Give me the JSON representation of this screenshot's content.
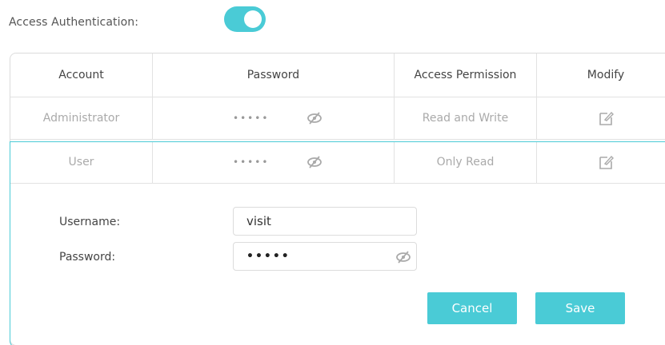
{
  "auth": {
    "label": "Access Authentication:",
    "enabled": true
  },
  "table": {
    "headers": [
      "Account",
      "Password",
      "Access Permission",
      "Modify"
    ],
    "rows": [
      {
        "account": "Administrator",
        "password_mask": "•••••",
        "permission": "Read and Write"
      },
      {
        "account": "User",
        "password_mask": "•••••",
        "permission": "Only Read"
      }
    ]
  },
  "form": {
    "username_label": "Username:",
    "username_value": "visit",
    "password_label": "Password:",
    "password_mask": "•••••"
  },
  "buttons": {
    "cancel": "Cancel",
    "save": "Save"
  },
  "colors": {
    "accent": "#4acbd6",
    "border": "#dcdcdc"
  },
  "icons": {
    "password_toggle": "eye-slash-icon",
    "modify": "edit-icon"
  }
}
